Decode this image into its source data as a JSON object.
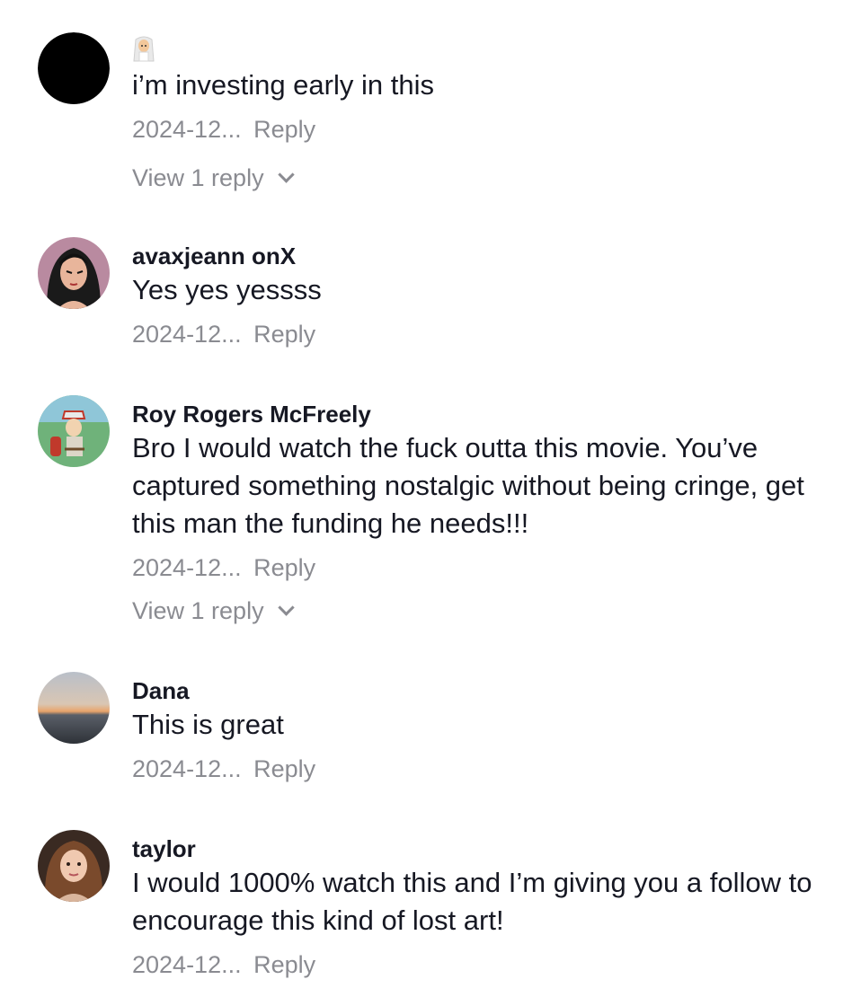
{
  "comments": [
    {
      "username": "",
      "username_emoji": "person-with-veil-emoji",
      "text": "i’m investing early in this",
      "date": "2024-12...",
      "reply_label": "Reply",
      "view_replies": "View 1 reply",
      "avatar": "black-circle"
    },
    {
      "username": "avaxjeann onX",
      "text": "Yes yes yessss",
      "date": "2024-12...",
      "reply_label": "Reply",
      "avatar": "cartoon-woman"
    },
    {
      "username": "Roy Rogers McFreely",
      "text": "Bro I would watch the fuck outta this movie. You’ve captured something nostalgic without being cringe, get this man the funding he needs!!!",
      "date": "2024-12...",
      "reply_label": "Reply",
      "view_replies": "View 1 reply",
      "avatar": "cartoon-fire-chief"
    },
    {
      "username": "Dana",
      "text": "This is great",
      "date": "2024-12...",
      "reply_label": "Reply",
      "avatar": "sunset-sea"
    },
    {
      "username": "taylor",
      "text": "I would 1000% watch this and I’m giving you a follow to encourage this kind of lost art!",
      "date": "2024-12...",
      "reply_label": "Reply",
      "avatar": "woman-selfie"
    }
  ],
  "colors": {
    "text_primary": "#161823",
    "text_secondary": "#8a8b91",
    "background": "#ffffff"
  }
}
